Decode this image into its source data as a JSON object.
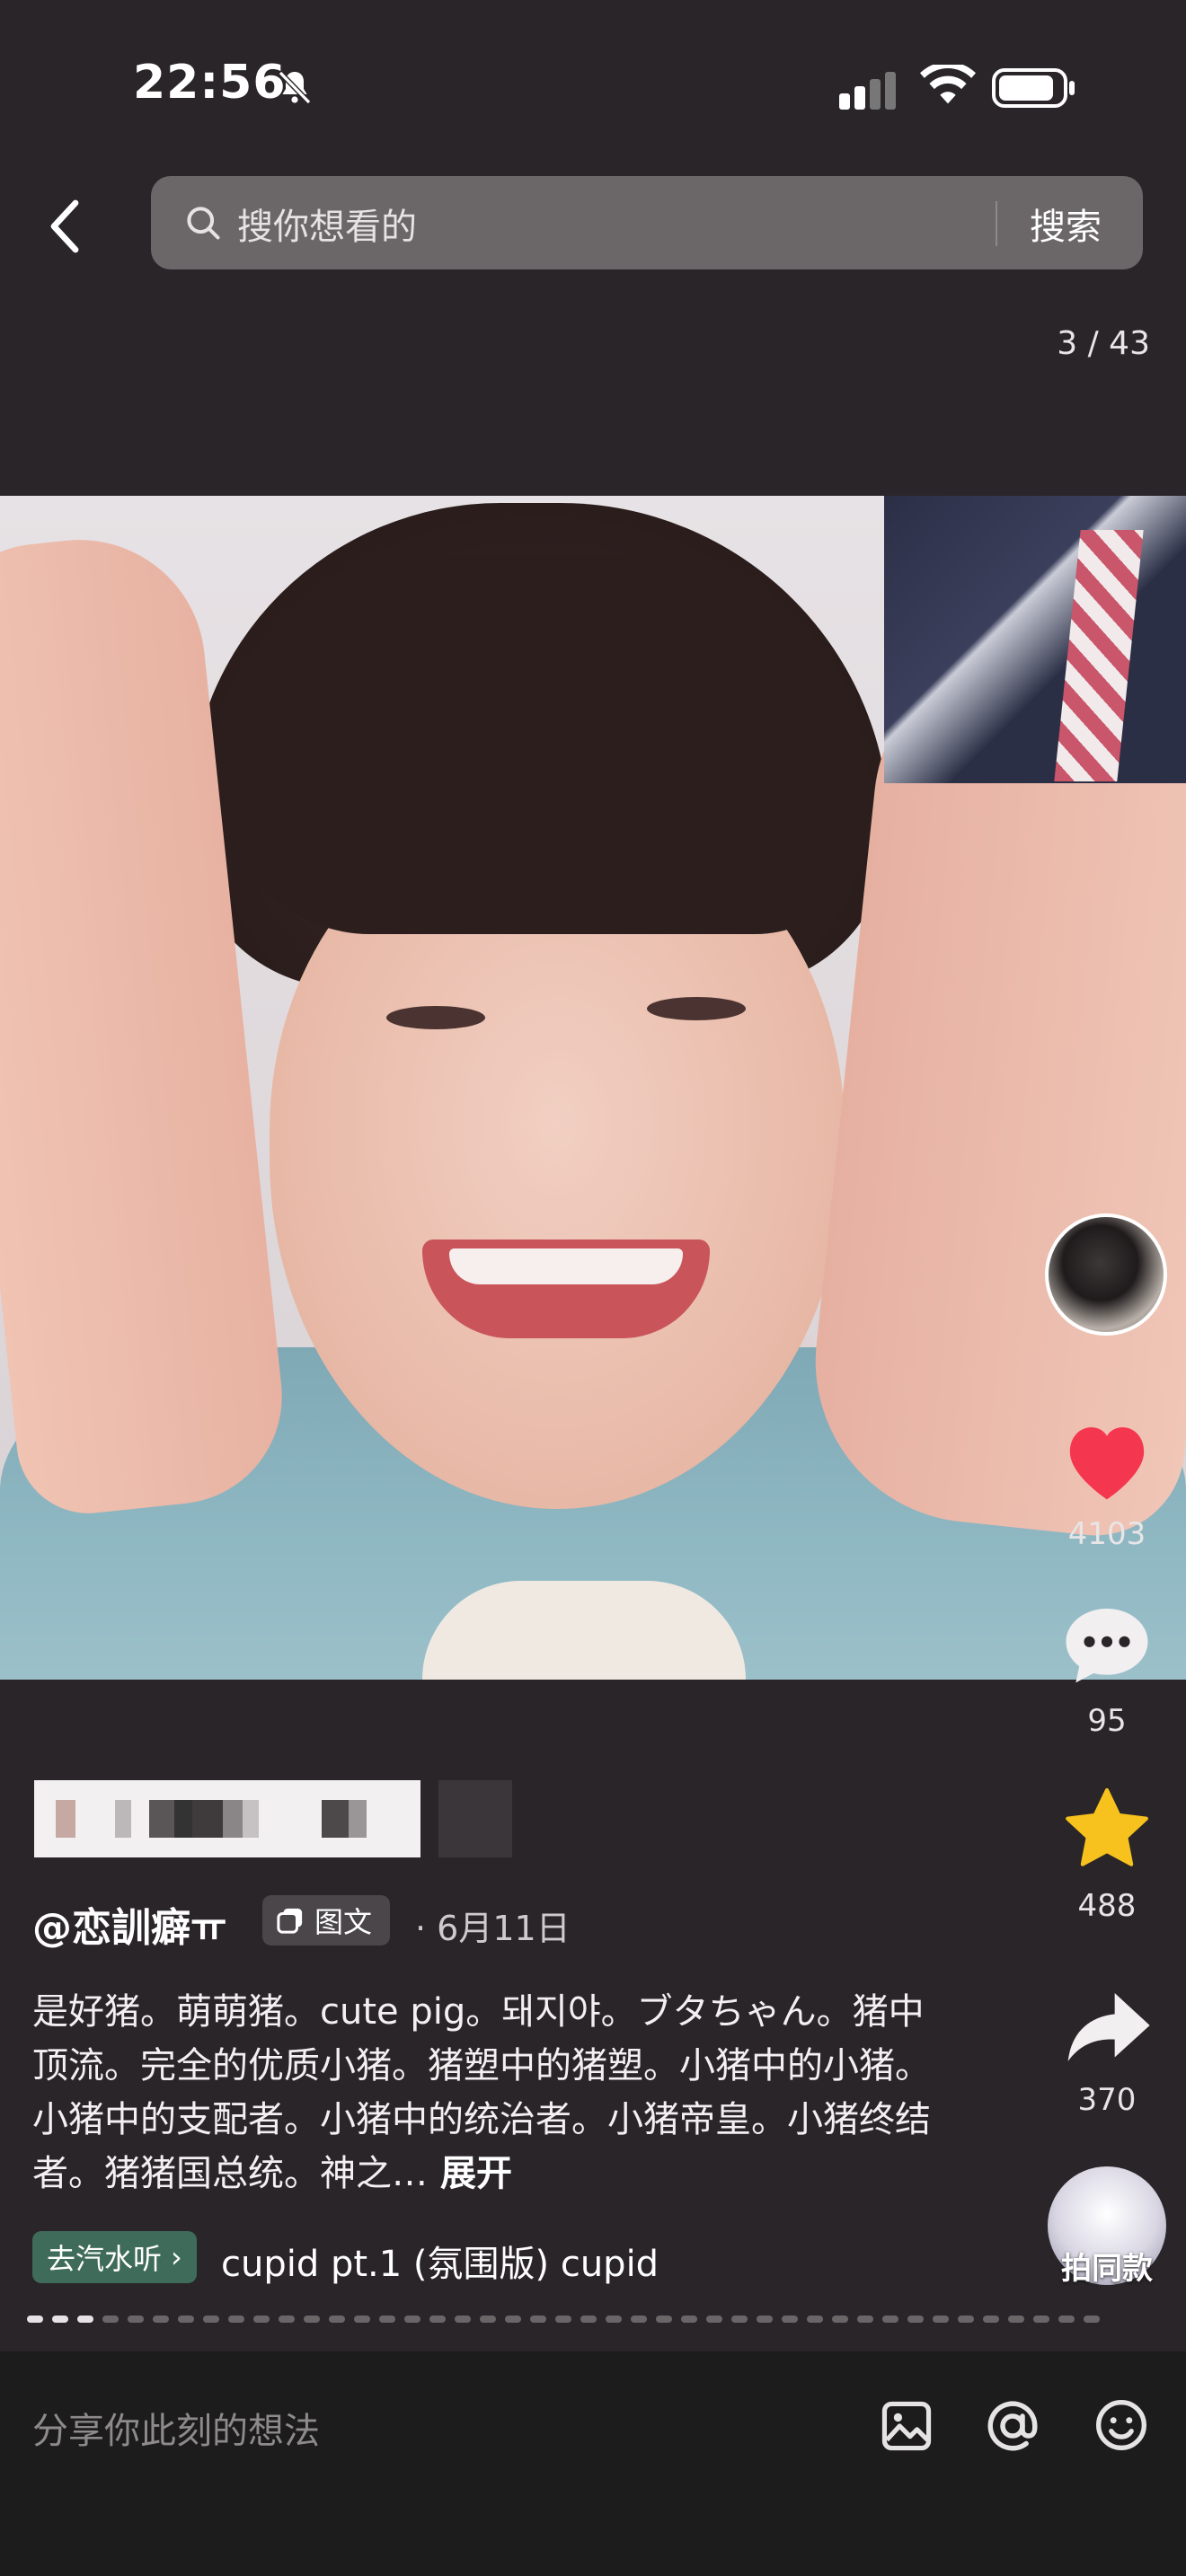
{
  "status_bar": {
    "time": "22:56"
  },
  "search": {
    "placeholder": "搜你想看的",
    "button_label": "搜索"
  },
  "page_counter": "3 / 43",
  "interactions": {
    "likes": "4103",
    "comments": "95",
    "favorites": "488",
    "shares": "370",
    "same_style_label": "拍同款"
  },
  "post": {
    "author": "@恋訓癖ㅠ",
    "type_label": "图文",
    "date": "· 6月11日",
    "caption": "是好猪。萌萌猪。cute pig。돼지야。ブタちゃん。猪中顶流。完全的优质小猪。猪塑中的猪塑。小猪中的小猪。小猪中的支配者。小猪中的统治者。小猪帝皇。小猪终结者。猪猪国总统。神之…",
    "expand_label": "展开",
    "music_badge": "去汽水听",
    "music_title": "cupid pt.1 (氛围版)  cupid"
  },
  "carousel": {
    "current": 3,
    "total": 43
  },
  "comment_bar": {
    "placeholder": "分享你此刻的想法"
  },
  "colors": {
    "like": "#f5364f",
    "favorite": "#f7c21d",
    "music_badge": "#3f6b5a"
  },
  "icons": [
    "back-icon",
    "search-icon",
    "bell-muted-icon",
    "signal-icon",
    "wifi-icon",
    "battery-icon",
    "heart-icon",
    "comment-icon",
    "star-icon",
    "share-icon",
    "image-icon",
    "at-icon",
    "emoji-icon"
  ]
}
